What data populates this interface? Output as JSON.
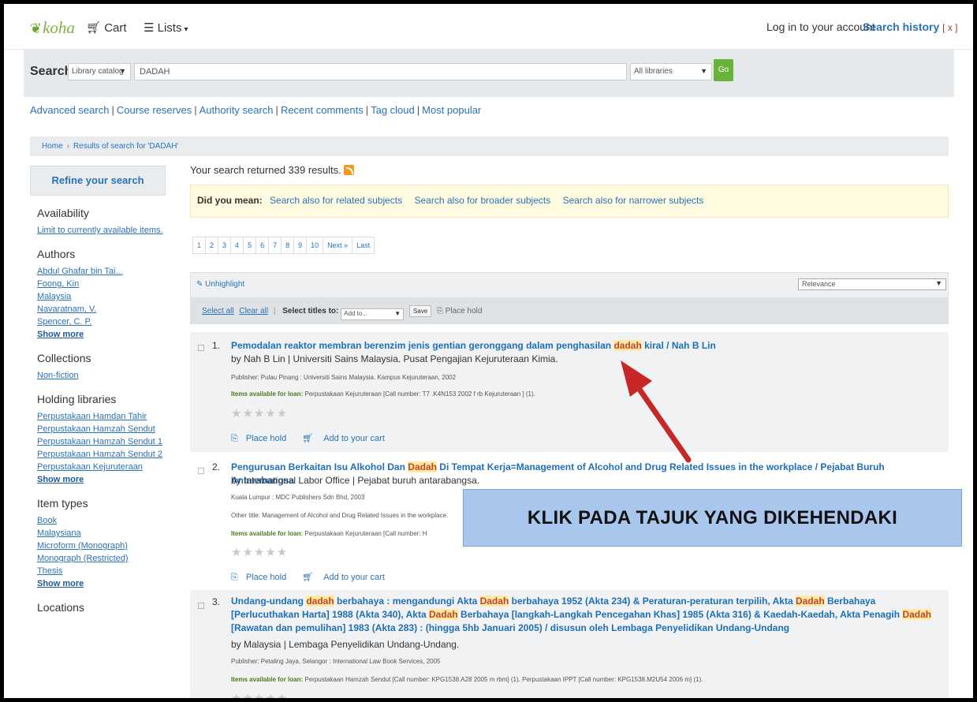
{
  "navbar": {
    "logo": "koha",
    "cart": "Cart",
    "lists": "Lists",
    "login": "Log in to your account",
    "search_history": "Search history",
    "search_history_clear": "[ x ]"
  },
  "search": {
    "label": "Search",
    "scope": "Library catalog",
    "query": "DADAH",
    "libraries": "All libraries",
    "go": "Go"
  },
  "links": [
    "Advanced search",
    "Course reserves",
    "Authority search",
    "Recent comments",
    "Tag cloud",
    "Most popular"
  ],
  "breadcrumb": {
    "home": "Home",
    "current": "Results of search for 'DADAH'"
  },
  "sidebar": {
    "heading": "Refine your search",
    "availability": {
      "title": "Availability",
      "items": [
        "Limit to currently available items."
      ]
    },
    "authors": {
      "title": "Authors",
      "items": [
        "Abdul Ghafar bin Tai...",
        "Foong, Kin",
        "Malaysia",
        "Navaratnam, V.",
        "Spencer, C. P."
      ],
      "more": "Show more"
    },
    "collections": {
      "title": "Collections",
      "items": [
        "Non-fiction"
      ]
    },
    "holding_libraries": {
      "title": "Holding libraries",
      "items": [
        "Perpustakaan Hamdan Tahir",
        "Perpustakaan Hamzah Sendut",
        "Perpustakaan Hamzah Sendut 1",
        "Perpustakaan Hamzah Sendut 2",
        "Perpustakaan Kejuruteraan"
      ],
      "more": "Show more"
    },
    "item_types": {
      "title": "Item types",
      "items": [
        "Book",
        "Malaysiana",
        "Microform (Monograph)",
        "Monograph (Restricted)",
        "Thesis"
      ],
      "more": "Show more"
    },
    "locations": {
      "title": "Locations"
    }
  },
  "results": {
    "count_text": "Your search returned 339 results.",
    "did_you_mean": {
      "label": "Did you mean:",
      "options": [
        "Search also for related subjects",
        "Search also for broader subjects",
        "Search also for narrower subjects"
      ]
    },
    "pages": [
      "1",
      "2",
      "3",
      "4",
      "5",
      "6",
      "7",
      "8",
      "9",
      "10",
      "Next »",
      "Last"
    ],
    "unhighlight": "Unhighlight",
    "sort": "Relevance",
    "select_all": "Select all",
    "clear_all": "Clear all",
    "select_titles": "Select titles to:",
    "add_to": "Add to...",
    "save": "Save",
    "place_hold": "Place hold",
    "items": [
      {
        "num": "1.",
        "title_pre": "Pemodalan reaktor membran berenzim jenis gentian geronggang dalam penghasilan ",
        "title_hl": "dadah",
        "title_post": " kiral / Nah B Lin",
        "by": "by Nah B Lin | Universiti Sains Malaysia. Pusat Pengajian Kejuruteraan Kimia.",
        "publisher": "Publisher: Pulau Pinang : Universiti Sains Malaysia. Kampus Kejuruteraan, 2002",
        "availability_label": "Items available for loan:",
        "availability": " Perpustakaan Kejuruteraan [Call number: T7 .K4N153 2002 f rb Kejuruteraan ] (1).",
        "place_hold": "Place hold",
        "add_cart": "Add to your cart"
      },
      {
        "num": "2.",
        "title_pre": "Pengurusan Berkaitan Isu Alkohol Dan ",
        "title_hl": "Dadah",
        "title_post": " Di Tempat Kerja=Management of Alcohol and Drug Related Issues in the workplace / Pejabat Buruh Antarabangsa",
        "by": "by International Labor Office | Pejabat buruh antarabangsa.",
        "publisher": "Kuala Lumpur : MDC Publishers Sdn Bhd, 2003",
        "other_title": "Other title: Management of Alcohol and Drug Related Issues in the workplace.",
        "availability_label": "Items available for loan:",
        "availability": " Perpustakaan Kejuruteraan [Call number: H",
        "place_hold": "Place hold",
        "add_cart": "Add to your cart"
      },
      {
        "num": "3.",
        "title_html_parts": [
          "Undang-undang ",
          "dadah",
          " berbahaya : mengandungi Akta ",
          "Dadah",
          " berbahaya 1952 (Akta 234) & Peraturan-peraturan terpilih, Akta ",
          "Dadah",
          " Berbahaya [Perlucuthakan Harta] 1988 (Akta 340), Akta ",
          "Dadah",
          " Berbahaya [langkah-Langkah Pencegahan Khas] 1985 (Akta 316) & Kaedah-Kaedah, Akta Penagih ",
          "Dadah",
          " [Rawatan dan pemulihan] 1983 (Akta 283) : (hingga 5hb Januari 2005) / disusun oleh Lembaga Penyelidikan Undang-Undang"
        ],
        "by": "by Malaysia | Lembaga Penyelidikan Undang-Undang.",
        "publisher": "Publisher: Petaling Jaya, Selangor : International Law Book Services, 2005",
        "availability_label": "Items available for loan:",
        "availability": " Perpustakaan Hamzah Sendut [Call number: KPG1538.A28 2005 m rbm] (1). Perpustakaan IPPT [Call number: KPG1538.M2U54 2006 m] (1)."
      }
    ]
  },
  "annotation": {
    "text": "KLIK PADA TAJUK YANG DIKEHENDAKI",
    "color": "#c62828"
  }
}
